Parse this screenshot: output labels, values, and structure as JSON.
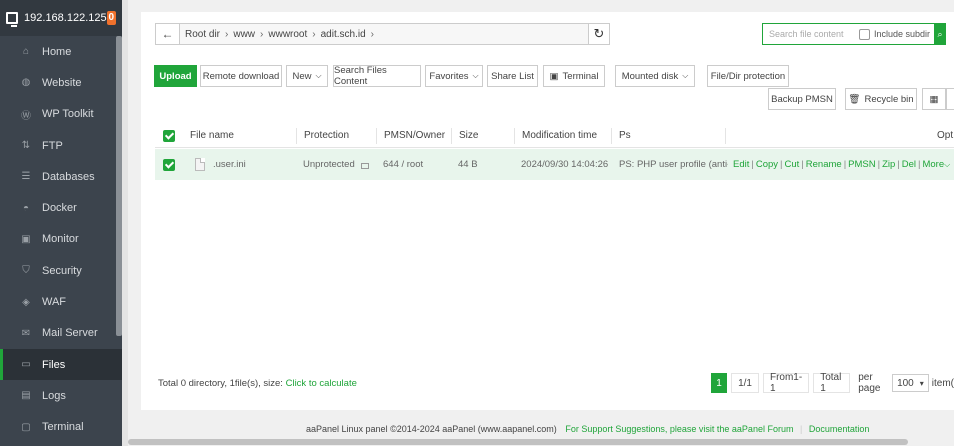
{
  "sidebar": {
    "ip": "192.168.122.125",
    "badge": "0",
    "items": [
      {
        "label": "Home",
        "icon": "home-icon",
        "glyph": "⌂"
      },
      {
        "label": "Website",
        "icon": "globe-icon",
        "glyph": "◍"
      },
      {
        "label": "WP Toolkit",
        "icon": "wordpress-icon",
        "glyph": "Ⓦ"
      },
      {
        "label": "FTP",
        "icon": "ftp-icon",
        "glyph": "⇅"
      },
      {
        "label": "Databases",
        "icon": "database-icon",
        "glyph": "☰"
      },
      {
        "label": "Docker",
        "icon": "docker-icon",
        "glyph": "◓"
      },
      {
        "label": "Monitor",
        "icon": "monitor-icon",
        "glyph": "▣"
      },
      {
        "label": "Security",
        "icon": "shield-icon",
        "glyph": "⛉"
      },
      {
        "label": "WAF",
        "icon": "waf-shield-icon",
        "glyph": "◈"
      },
      {
        "label": "Mail Server",
        "icon": "mail-icon",
        "glyph": "✉"
      },
      {
        "label": "Files",
        "icon": "folder-icon",
        "glyph": "▭"
      },
      {
        "label": "Logs",
        "icon": "logs-icon",
        "glyph": "▤"
      },
      {
        "label": "Terminal",
        "icon": "terminal-icon",
        "glyph": "▢"
      }
    ],
    "active_index": 10
  },
  "breadcrumb": [
    "Root dir",
    "www",
    "wwwroot",
    "adit.sch.id"
  ],
  "search": {
    "placeholder": "Search file content",
    "include_subdir": "Include subdir"
  },
  "toolbar": {
    "upload": "Upload",
    "remote_download": "Remote download",
    "new": "New",
    "search_files_content": "Search Files Content",
    "favorites": "Favorites",
    "share_list": "Share List",
    "terminal": "Terminal",
    "mounted_disk": "Mounted disk",
    "file_dir_protection": "File/Dir protection",
    "backup_pmsn": "Backup PMSN",
    "recycle_bin": "Recycle bin"
  },
  "table": {
    "headers": {
      "name": "File name",
      "protection": "Protection",
      "pmsn": "PMSN/Owner",
      "size": "Size",
      "mtime": "Modification time",
      "ps": "Ps",
      "opt": "Opt"
    },
    "rows": [
      {
        "name": ".user.ini",
        "protection": "Unprotected",
        "pmsn": "644 / root",
        "size": "44 B",
        "mtime": "2024/09/30 14:04:26",
        "ps": "PS: PHP user profile (anti-cros"
      }
    ],
    "ops": [
      "Edit",
      "Copy",
      "Cut",
      "Rename",
      "PMSN",
      "Zip",
      "Del",
      "More"
    ]
  },
  "summary": {
    "text": "Total 0 directory, 1file(s), size:",
    "link": "Click to calculate"
  },
  "pager": {
    "current": "1",
    "pages": "1/1",
    "range": "From1-1",
    "total": "Total 1",
    "per_page_label": "per page",
    "per_page": "100",
    "items": "item("
  },
  "footer": {
    "copyright": "aaPanel Linux panel ©2014-2024 aaPanel (www.aapanel.com)",
    "support": "For Support Suggestions, please visit the aaPanel Forum",
    "docs": "Documentation"
  }
}
